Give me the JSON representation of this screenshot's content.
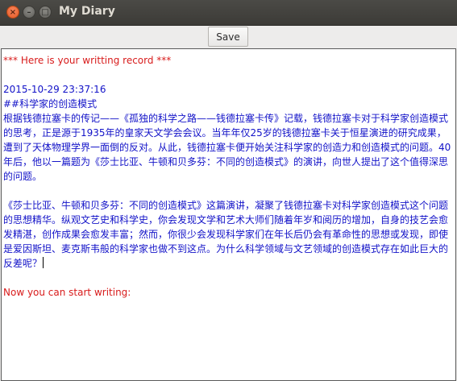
{
  "window": {
    "title": "My Diary",
    "close_glyph": "×",
    "minimize_glyph": "–",
    "maximize_glyph": "□"
  },
  "toolbar": {
    "save_label": "Save"
  },
  "editor": {
    "header": "*** Here is your writting record ***",
    "timestamp": "2015-10-29 23:37:16",
    "entry_title": "##科学家的创造模式",
    "paragraph1": "根据钱德拉塞卡的传记——《孤独的科学之路——钱德拉塞卡传》记载，钱德拉塞卡对于科学家创造模式的思考，正是源于1935年的皇家天文学会会议。当年年仅25岁的钱德拉塞卡关于恒星演进的研究成果，遭到了天体物理学界一面倒的反对。从此，钱德拉塞卡便开始关注科学家的创造力和创造模式的问题。40年后，他以一篇题为《莎士比亚、牛顿和贝多芬：不同的创造模式》的演讲，向世人提出了这个值得深思的问题。",
    "paragraph2": "《莎士比亚、牛顿和贝多芬：不同的创造模式》这篇演讲，凝聚了钱德拉塞卡对科学家创造模式这个问题的思想精华。纵观文艺史和科学史，你会发现文学和艺术大师们随着年岁和阅历的增加，自身的技艺会愈发精湛，创作成果会愈发丰富；然而，你很少会发现科学家们在年长后仍会有革命性的思想或发现，即使是爱因斯坦、麦克斯韦般的科学家也做不到这点。为什么科学领域与文艺领域的创造模式存在如此巨大的反差呢？",
    "prompt": "Now you can start writing:",
    "colors": {
      "system_text": "#d81b1b",
      "diary_text": "#1212c8"
    }
  }
}
